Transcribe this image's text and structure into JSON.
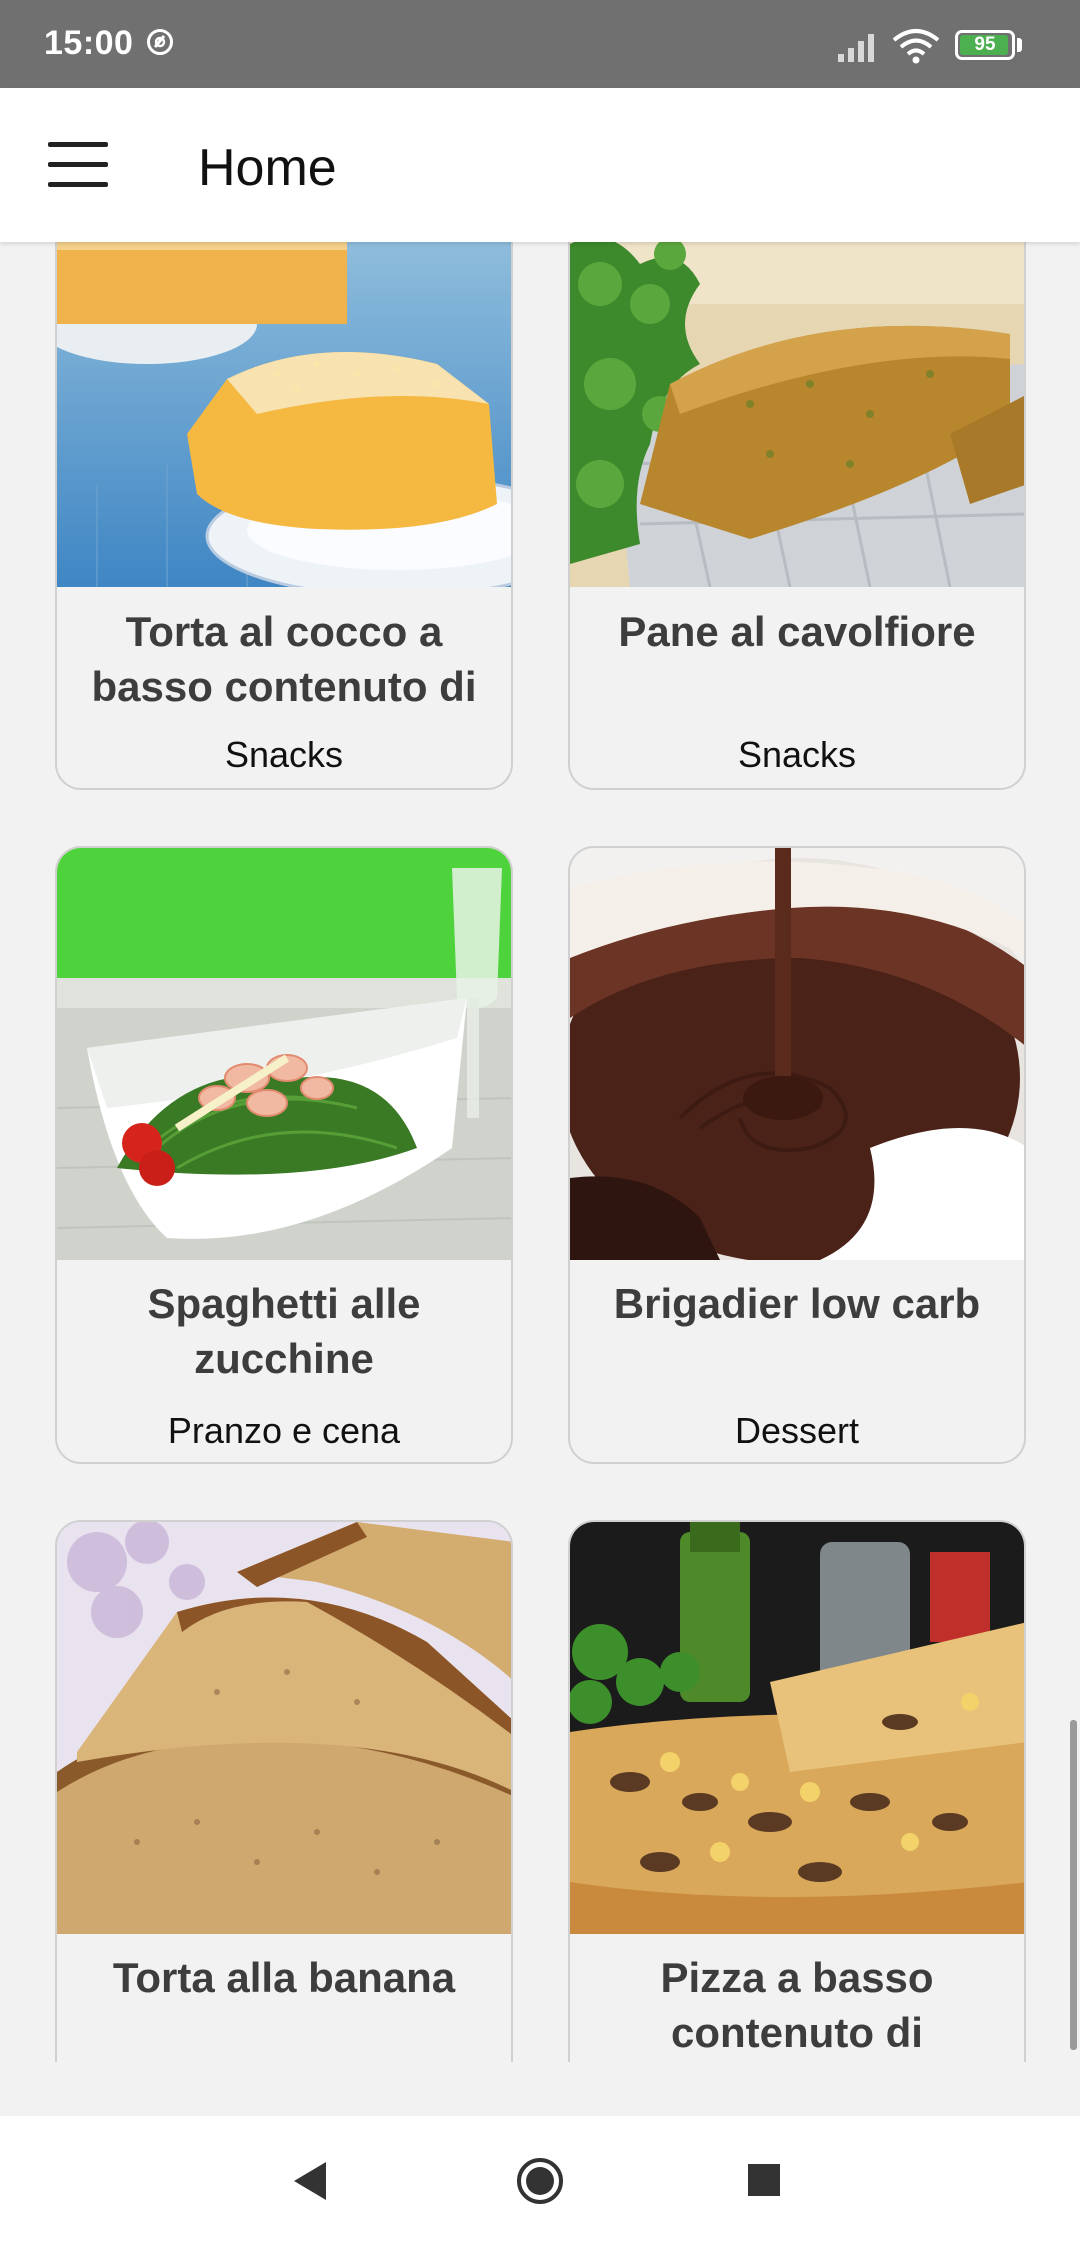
{
  "status_bar": {
    "time": "15:00",
    "battery": "95",
    "battery_level": 0.95,
    "icons": [
      "at-sign-icon",
      "signal-icon",
      "wifi-icon",
      "battery-icon"
    ]
  },
  "app_bar": {
    "title": "Home",
    "menu_icon": "hamburger-menu-icon"
  },
  "recipes": [
    {
      "title": "Torta al cocco a basso contenuto di",
      "category": "Snacks"
    },
    {
      "title": "Pane al cavolfiore",
      "category": "Snacks"
    },
    {
      "title": "Spaghetti alle zucchine",
      "category": "Pranzo e cena"
    },
    {
      "title": "Brigadier low carb",
      "category": "Dessert"
    },
    {
      "title": "Torta alla banana",
      "category": ""
    },
    {
      "title": "Pizza a basso contenuto di",
      "category": ""
    }
  ],
  "nav_bar": {
    "icons": [
      "back-icon",
      "home-icon",
      "recents-icon"
    ]
  },
  "colors": {
    "status_bar": "#707070",
    "battery_green": "#4caf50",
    "card_border": "#d0d0d0",
    "background": "#f2f2f2"
  }
}
